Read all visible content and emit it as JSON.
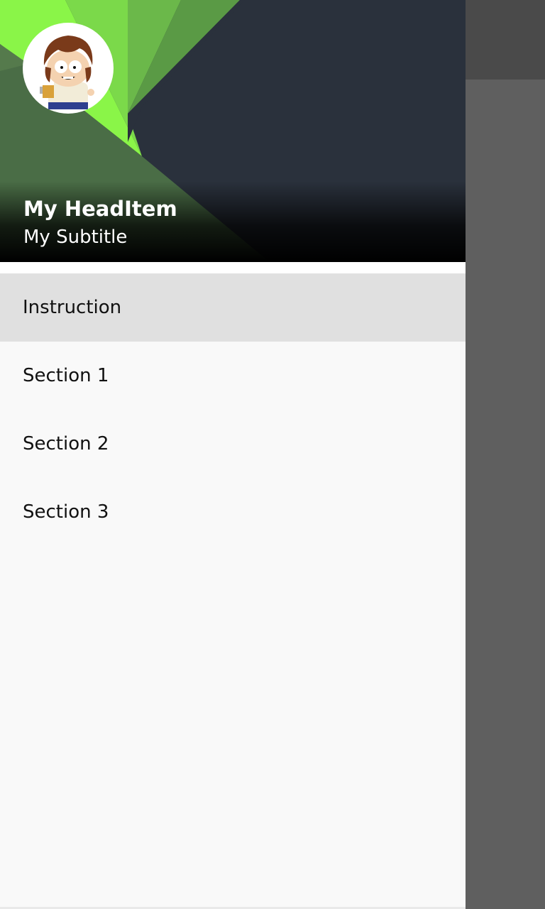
{
  "header": {
    "title": "My HeadItem",
    "subtitle": "My Subtitle",
    "avatar_icon": "avatar-cartoon-character-icon",
    "background_colors": {
      "dark": "#2a313c",
      "green_bright": "#8af548",
      "green_mid": "#6bb84a",
      "green_dark": "#4a6d46"
    }
  },
  "menu": {
    "items": [
      {
        "label": "Instruction",
        "selected": true
      },
      {
        "label": "Section 1",
        "selected": false
      },
      {
        "label": "Section 2",
        "selected": false
      },
      {
        "label": "Section 3",
        "selected": false
      }
    ],
    "selected_background": "#e0e0e0"
  },
  "scrim": {
    "color": "#5f5f5f",
    "toolbar_color": "#4a4a4a"
  }
}
